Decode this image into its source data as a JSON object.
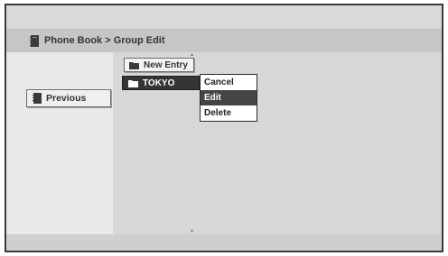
{
  "header": {
    "breadcrumb": "Phone Book > Group Edit"
  },
  "sidebar": {
    "previous_label": "Previous"
  },
  "list": {
    "items": [
      {
        "label": "New Entry",
        "icon": "folder-icon"
      },
      {
        "label": "TOKYO",
        "icon": "folder-icon",
        "selected": true
      }
    ]
  },
  "context_menu": {
    "items": [
      {
        "label": "Cancel"
      },
      {
        "label": "Edit",
        "selected": true
      },
      {
        "label": "Delete"
      }
    ]
  },
  "scroll": {
    "up": "▴",
    "down": "▾"
  }
}
